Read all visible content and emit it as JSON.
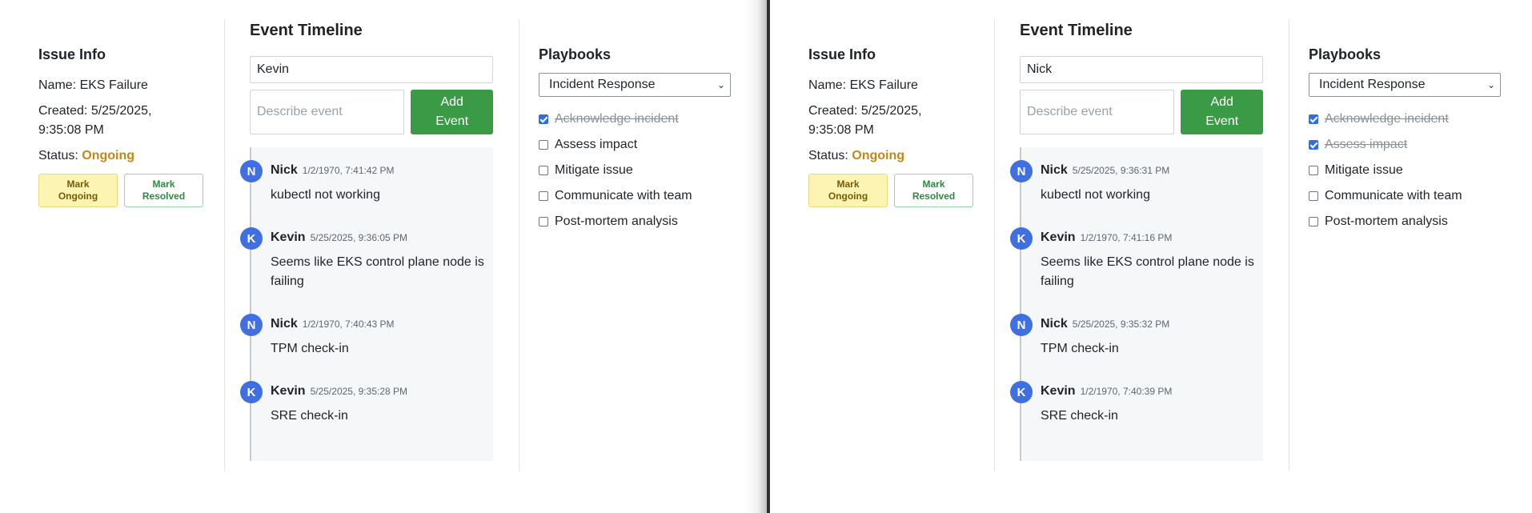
{
  "left": {
    "issue": {
      "heading": "Issue Info",
      "name": "Name: EKS Failure",
      "created": "Created: 5/25/2025,",
      "created2": "9:35:08 PM",
      "status_label": "Status: ",
      "status_value": "Ongoing",
      "mark_ongoing_1": "Mark",
      "mark_ongoing_2": "Ongoing",
      "mark_resolved_1": "Mark",
      "mark_resolved_2": "Resolved"
    },
    "timeline": {
      "heading": "Event Timeline",
      "name_value": "Kevin",
      "desc_placeholder": "Describe event",
      "add_1": "Add",
      "add_2": "Event",
      "events": [
        {
          "initial": "N",
          "name": "Nick",
          "time": "1/2/1970, 7:41:42 PM",
          "text": "kubectl not working"
        },
        {
          "initial": "K",
          "name": "Kevin",
          "time": "5/25/2025, 9:36:05 PM",
          "text": "Seems like EKS control plane node is failing"
        },
        {
          "initial": "N",
          "name": "Nick",
          "time": "1/2/1970, 7:40:43 PM",
          "text": "TPM check-in"
        },
        {
          "initial": "K",
          "name": "Kevin",
          "time": "5/25/2025, 9:35:28 PM",
          "text": "SRE check-in"
        }
      ]
    },
    "playbooks": {
      "heading": "Playbooks",
      "selected": "Incident Response",
      "items": [
        {
          "label": "Acknowledge incident",
          "checked": true
        },
        {
          "label": "Assess impact",
          "checked": false
        },
        {
          "label": "Mitigate issue",
          "checked": false
        },
        {
          "label": "Communicate with team",
          "checked": false
        },
        {
          "label": "Post-mortem analysis",
          "checked": false
        }
      ]
    }
  },
  "right": {
    "issue": {
      "heading": "Issue Info",
      "name": "Name: EKS Failure",
      "created": "Created: 5/25/2025,",
      "created2": "9:35:08 PM",
      "status_label": "Status: ",
      "status_value": "Ongoing",
      "mark_ongoing_1": "Mark",
      "mark_ongoing_2": "Ongoing",
      "mark_resolved_1": "Mark",
      "mark_resolved_2": "Resolved"
    },
    "timeline": {
      "heading": "Event Timeline",
      "name_value": "Nick",
      "desc_placeholder": "Describe event",
      "add_1": "Add",
      "add_2": "Event",
      "events": [
        {
          "initial": "N",
          "name": "Nick",
          "time": "5/25/2025, 9:36:31 PM",
          "text": "kubectl not working"
        },
        {
          "initial": "K",
          "name": "Kevin",
          "time": "1/2/1970, 7:41:16 PM",
          "text": "Seems like EKS control plane node is failing"
        },
        {
          "initial": "N",
          "name": "Nick",
          "time": "5/25/2025, 9:35:32 PM",
          "text": "TPM check-in"
        },
        {
          "initial": "K",
          "name": "Kevin",
          "time": "1/2/1970, 7:40:39 PM",
          "text": "SRE check-in"
        }
      ]
    },
    "playbooks": {
      "heading": "Playbooks",
      "selected": "Incident Response",
      "items": [
        {
          "label": "Acknowledge incident",
          "checked": true
        },
        {
          "label": "Assess impact",
          "checked": true
        },
        {
          "label": "Mitigate issue",
          "checked": false
        },
        {
          "label": "Communicate with team",
          "checked": false
        },
        {
          "label": "Post-mortem analysis",
          "checked": false
        }
      ]
    }
  },
  "colors": {
    "status": "#c98512",
    "avatar": "#3f6fe0",
    "add_button": "#3a9a46",
    "checkbox": "#2f6fe4"
  }
}
